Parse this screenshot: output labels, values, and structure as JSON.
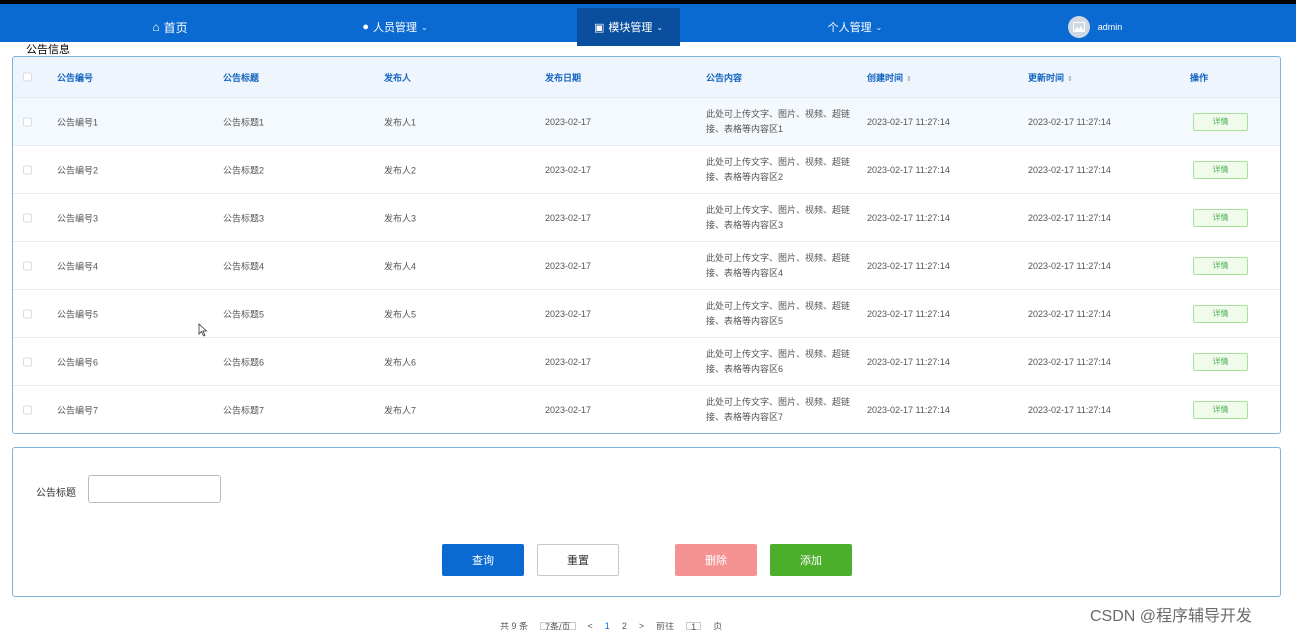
{
  "nav": {
    "home": "首页",
    "staff": "人员管理",
    "module": "模块管理",
    "personal": "个人管理",
    "user": "admin"
  },
  "breadcrumb": "公告信息",
  "table": {
    "headers": [
      "公告编号",
      "公告标题",
      "发布人",
      "发布日期",
      "公告内容",
      "创建时间",
      "更新时间",
      "操作"
    ],
    "rows": [
      {
        "code": "公告编号1",
        "title": "公告标题1",
        "publisher": "发布人1",
        "date": "2023-02-17",
        "content": "此处可上传文字、图片、视频、超链接、表格等内容区1",
        "created": "2023-02-17 11:27:14",
        "updated": "2023-02-17 11:27:14",
        "action": "详情"
      },
      {
        "code": "公告编号2",
        "title": "公告标题2",
        "publisher": "发布人2",
        "date": "2023-02-17",
        "content": "此处可上传文字、图片、视频、超链接、表格等内容区2",
        "created": "2023-02-17 11:27:14",
        "updated": "2023-02-17 11:27:14",
        "action": "详情"
      },
      {
        "code": "公告编号3",
        "title": "公告标题3",
        "publisher": "发布人3",
        "date": "2023-02-17",
        "content": "此处可上传文字、图片、视频、超链接、表格等内容区3",
        "created": "2023-02-17 11:27:14",
        "updated": "2023-02-17 11:27:14",
        "action": "详情"
      },
      {
        "code": "公告编号4",
        "title": "公告标题4",
        "publisher": "发布人4",
        "date": "2023-02-17",
        "content": "此处可上传文字、图片、视频、超链接、表格等内容区4",
        "created": "2023-02-17 11:27:14",
        "updated": "2023-02-17 11:27:14",
        "action": "详情"
      },
      {
        "code": "公告编号5",
        "title": "公告标题5",
        "publisher": "发布人5",
        "date": "2023-02-17",
        "content": "此处可上传文字、图片、视频、超链接、表格等内容区5",
        "created": "2023-02-17 11:27:14",
        "updated": "2023-02-17 11:27:14",
        "action": "详情"
      },
      {
        "code": "公告编号6",
        "title": "公告标题6",
        "publisher": "发布人6",
        "date": "2023-02-17",
        "content": "此处可上传文字、图片、视频、超链接、表格等内容区6",
        "created": "2023-02-17 11:27:14",
        "updated": "2023-02-17 11:27:14",
        "action": "详情"
      },
      {
        "code": "公告编号7",
        "title": "公告标题7",
        "publisher": "发布人7",
        "date": "2023-02-17",
        "content": "此处可上传文字、图片、视频、超链接、表格等内容区7",
        "created": "2023-02-17 11:27:14",
        "updated": "2023-02-17 11:27:14",
        "action": "详情"
      }
    ]
  },
  "search": {
    "label": "公告标题",
    "value": "",
    "query": "查询",
    "reset": "重置",
    "delete": "删除",
    "add": "添加"
  },
  "pager": {
    "total": "共 9 条",
    "page_size": "7条/页",
    "page_1": "1",
    "page_2": "2",
    "goto": "前往",
    "page_input": "1",
    "page_unit": "页"
  },
  "watermark": "CSDN @程序辅导开发",
  "colors": {
    "primary": "#0b6ad2",
    "header_dark": "#0a4f9e",
    "danger": "#f59393",
    "success": "#4caf2c"
  }
}
